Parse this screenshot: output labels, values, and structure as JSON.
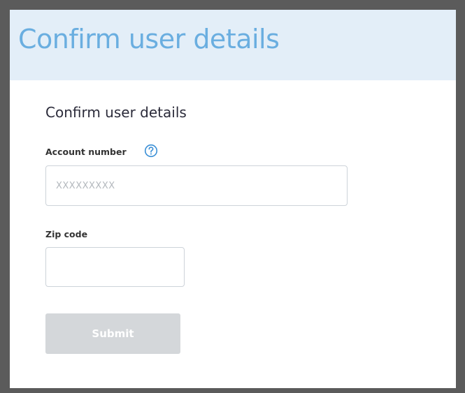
{
  "header": {
    "title": "Confirm user details"
  },
  "form": {
    "heading": "Confirm user details",
    "account_number": {
      "label": "Account number",
      "placeholder": "XXXXXXXXX",
      "value": "",
      "help_icon": "question-circle-icon"
    },
    "zip_code": {
      "label": "Zip code",
      "placeholder": "",
      "value": ""
    },
    "submit": {
      "label": "Submit",
      "state": "disabled"
    }
  },
  "colors": {
    "header_background": "#e3eef8",
    "header_title": "#6aaee0",
    "help_icon": "#3a8fd6",
    "submit_disabled_background": "#d4d7da",
    "window_border": "#5b5b5b"
  }
}
